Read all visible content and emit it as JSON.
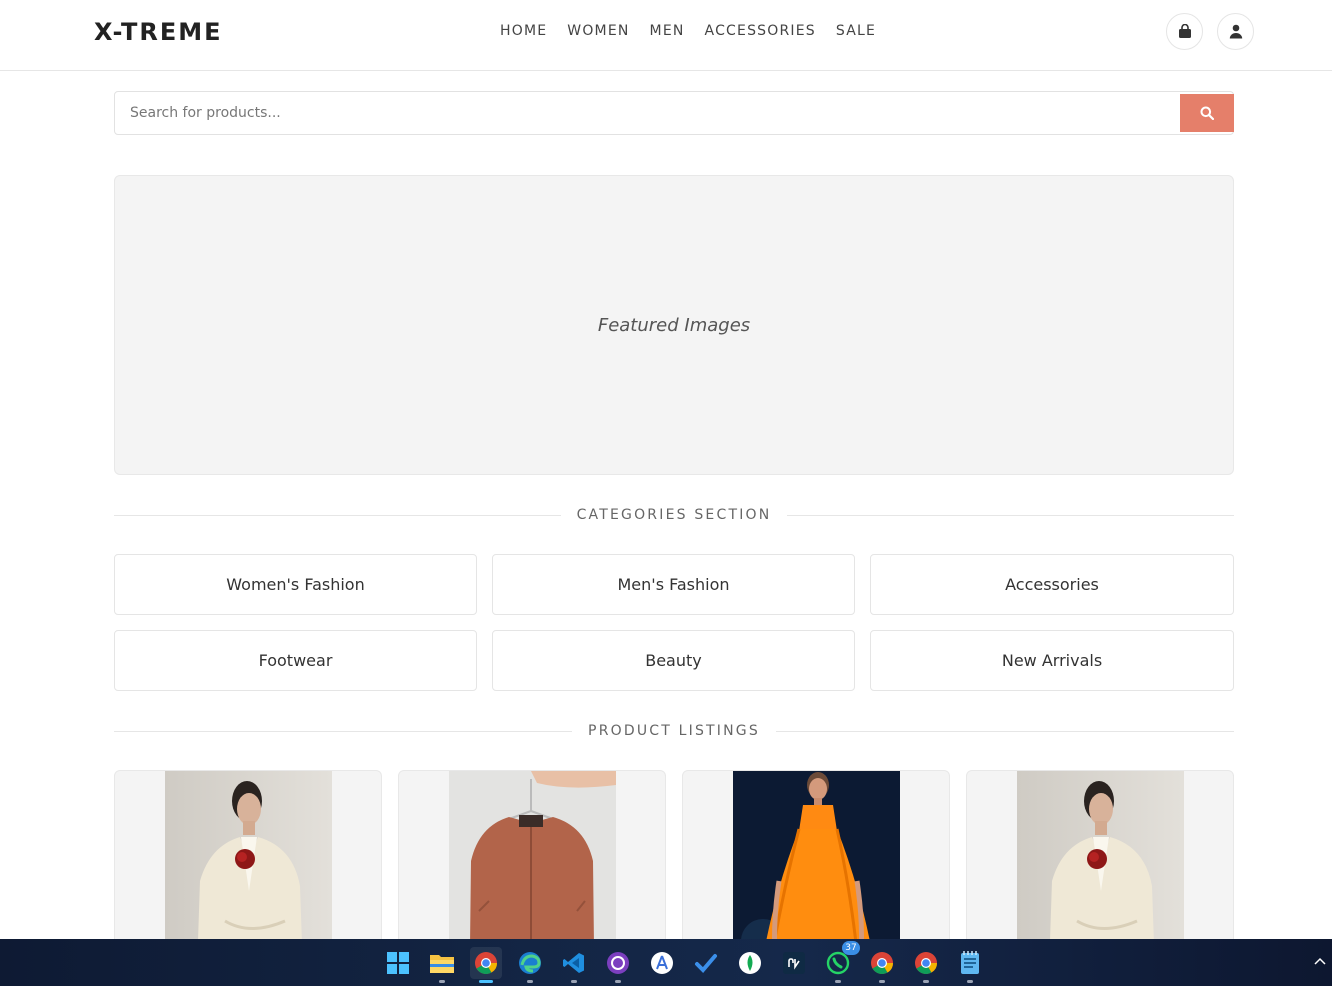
{
  "header": {
    "logo": "X-TREME",
    "nav": [
      "HOME",
      "WOMEN",
      "MEN",
      "ACCESSORIES",
      "SALE"
    ],
    "cart_icon": "shopping-bag-icon",
    "user_icon": "user-icon"
  },
  "search": {
    "placeholder": "Search for products...",
    "value": "",
    "button_icon": "search-icon",
    "button_color": "#e57f6a"
  },
  "featured": {
    "label": "Featured Images"
  },
  "categories": {
    "title": "CATEGORIES SECTION",
    "items": [
      "Women's Fashion",
      "Men's Fashion",
      "Accessories",
      "Footwear",
      "Beauty",
      "New Arrivals"
    ]
  },
  "products": {
    "title": "PRODUCT LISTINGS",
    "items": [
      {
        "image": "woman-in-cream-blazer-with-red-rose"
      },
      {
        "image": "rust-bomber-jacket-on-hanger"
      },
      {
        "image": "woman-in-orange-dress-on-dark-background"
      },
      {
        "image": "woman-in-cream-blazer-with-red-rose"
      }
    ]
  },
  "taskbar": {
    "icons": [
      "windows-start-icon",
      "file-explorer-icon",
      "chrome-icon",
      "edge-icon",
      "vscode-icon",
      "github-desktop-icon",
      "android-studio-icon",
      "todo-icon",
      "mongodb-compass-icon",
      "postman-icon",
      "whatsapp-icon",
      "chrome-profile-icon",
      "chrome-profile-2-icon",
      "notepad-icon"
    ],
    "whatsapp_badge": "37",
    "tray_icon": "chevron-up-icon"
  }
}
